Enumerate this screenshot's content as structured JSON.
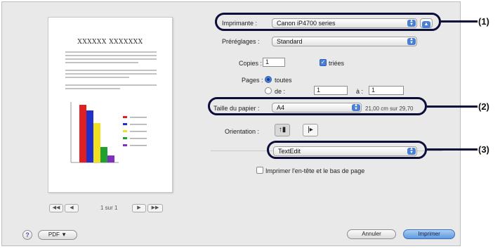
{
  "preview": {
    "doc_title": "XXXXXX XXXXXXX",
    "pager": {
      "first": "◀◀",
      "prev": "◀",
      "label": "1 sur 1",
      "next": "▶",
      "last": "▶▶"
    }
  },
  "form": {
    "printer_label": "Imprimante :",
    "printer_value": "Canon iP4700 series",
    "presets_label": "Préréglages :",
    "presets_value": "Standard",
    "copies_label": "Copies :",
    "copies_value": "1",
    "collated_label": "triées",
    "pages_label": "Pages :",
    "pages_all": "toutes",
    "pages_from_label": "de :",
    "pages_from_value": "1",
    "pages_to_label": "à :",
    "pages_to_value": "1",
    "paper_size_label": "Taille du papier :",
    "paper_size_value": "A4",
    "paper_size_dims": "21,00 cm sur 29,70",
    "orientation_label": "Orientation :",
    "app_menu_value": "TextEdit",
    "header_footer_label": "Imprimer l'en-tête et le bas de page"
  },
  "callouts": [
    "(1)",
    "(2)",
    "(3)"
  ],
  "footer": {
    "help_label": "?",
    "pdf_label": "PDF ▼",
    "cancel_label": "Annuler",
    "print_label": "Imprimer"
  },
  "icons": [
    "help-icon",
    "portrait-icon",
    "landscape-icon",
    "popup-arrows-icon",
    "disclosure-icon"
  ],
  "colors": {
    "accent": "#4a7fd3",
    "callout": "#0d0d3a"
  }
}
